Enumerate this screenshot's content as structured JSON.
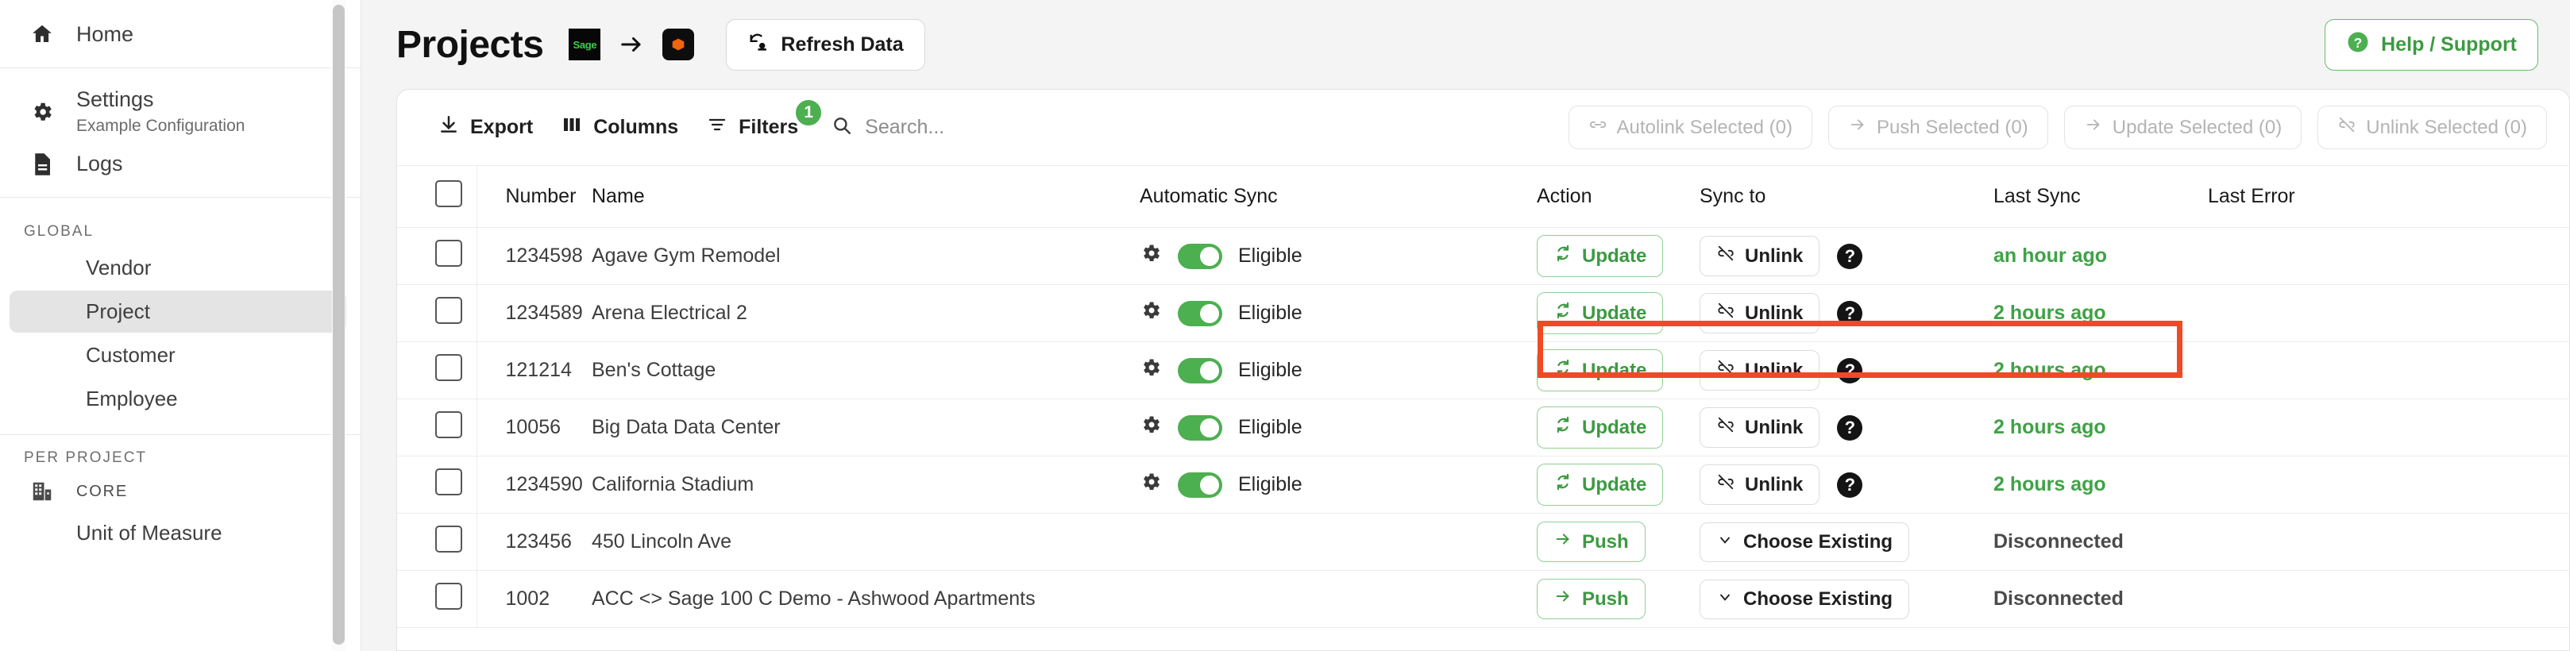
{
  "sidebar": {
    "top_items": [
      {
        "label": "Home",
        "icon": "home-icon",
        "sub": null
      }
    ],
    "mid_items": [
      {
        "label": "Settings",
        "icon": "gear-icon",
        "sub": "Example Configuration"
      },
      {
        "label": "Logs",
        "icon": "document-icon",
        "sub": null
      }
    ],
    "global_header": "GLOBAL",
    "global_items": [
      {
        "label": "Vendor",
        "active": false
      },
      {
        "label": "Project",
        "active": true
      },
      {
        "label": "Customer",
        "active": false
      },
      {
        "label": "Employee",
        "active": false
      }
    ],
    "per_project_header": "PER PROJECT",
    "core_label": "CORE",
    "core_icon": "building-icon",
    "cut_item": "Unit of Measure"
  },
  "header": {
    "title": "Projects",
    "source_logo_text": "Sage",
    "arrow_icon": "arrow-right-icon",
    "target_logo_icon": "command-center-icon",
    "refresh_label": "Refresh Data",
    "refresh_icon": "refresh-data-icon",
    "help_label": "Help / Support",
    "help_icon": "question-circle-icon"
  },
  "toolbar": {
    "export_label": "Export",
    "export_icon": "download-icon",
    "columns_label": "Columns",
    "columns_icon": "columns-icon",
    "filters_label": "Filters",
    "filters_icon": "filter-icon",
    "filters_badge": "1",
    "search_placeholder": "Search...",
    "search_value": "",
    "search_icon": "search-icon",
    "bulk_actions": [
      {
        "label": "Autolink Selected (0)",
        "icon": "link-icon",
        "disabled": true
      },
      {
        "label": "Push Selected (0)",
        "icon": "arrow-right-icon",
        "disabled": true
      },
      {
        "label": "Update Selected (0)",
        "icon": "arrow-right-icon",
        "disabled": true
      },
      {
        "label": "Unlink Selected (0)",
        "icon": "unlink-icon",
        "disabled": true
      }
    ]
  },
  "table": {
    "columns": [
      "",
      "Number",
      "Name",
      "Automatic Sync",
      "Action",
      "Sync to",
      "Last Sync",
      "Last Error"
    ],
    "rows": [
      {
        "number": "1234598",
        "name": "Agave Gym Remodel",
        "auto_sync": true,
        "auto_sync_label": "Eligible",
        "action_label": "Update",
        "action_icon": "refresh-icon",
        "action_style": "green",
        "sync_to_label": "Unlink",
        "sync_to_icon": "unlink-icon",
        "sync_to_style": "neutral",
        "has_help": true,
        "last_sync": "an hour ago",
        "last_sync_style": "ok",
        "last_error": "",
        "highlighted": true
      },
      {
        "number": "1234589",
        "name": "Arena Electrical 2",
        "auto_sync": true,
        "auto_sync_label": "Eligible",
        "action_label": "Update",
        "action_icon": "refresh-icon",
        "action_style": "green",
        "sync_to_label": "Unlink",
        "sync_to_icon": "unlink-icon",
        "sync_to_style": "neutral",
        "has_help": true,
        "last_sync": "2 hours ago",
        "last_sync_style": "ok",
        "last_error": "",
        "highlighted": false
      },
      {
        "number": "121214",
        "name": "Ben's Cottage",
        "auto_sync": true,
        "auto_sync_label": "Eligible",
        "action_label": "Update",
        "action_icon": "refresh-icon",
        "action_style": "green",
        "sync_to_label": "Unlink",
        "sync_to_icon": "unlink-icon",
        "sync_to_style": "neutral",
        "has_help": true,
        "last_sync": "2 hours ago",
        "last_sync_style": "ok",
        "last_error": "",
        "highlighted": false
      },
      {
        "number": "10056",
        "name": "Big Data Data Center",
        "auto_sync": true,
        "auto_sync_label": "Eligible",
        "action_label": "Update",
        "action_icon": "refresh-icon",
        "action_style": "green",
        "sync_to_label": "Unlink",
        "sync_to_icon": "unlink-icon",
        "sync_to_style": "neutral",
        "has_help": true,
        "last_sync": "2 hours ago",
        "last_sync_style": "ok",
        "last_error": "",
        "highlighted": false
      },
      {
        "number": "1234590",
        "name": "California Stadium",
        "auto_sync": true,
        "auto_sync_label": "Eligible",
        "action_label": "Update",
        "action_icon": "refresh-icon",
        "action_style": "green",
        "sync_to_label": "Unlink",
        "sync_to_icon": "unlink-icon",
        "sync_to_style": "neutral",
        "has_help": true,
        "last_sync": "2 hours ago",
        "last_sync_style": "ok",
        "last_error": "",
        "highlighted": false
      },
      {
        "number": "123456",
        "name": "450 Lincoln Ave",
        "auto_sync": null,
        "auto_sync_label": "",
        "action_label": "Push",
        "action_icon": "arrow-right-icon",
        "action_style": "green",
        "sync_to_label": "Choose Existing",
        "sync_to_icon": "chevron-down-icon",
        "sync_to_style": "neutral",
        "has_help": false,
        "last_sync": "Disconnected",
        "last_sync_style": "off",
        "last_error": "",
        "highlighted": false
      },
      {
        "number": "1002",
        "name": "ACC <> Sage 100 C Demo - Ashwood Apartments",
        "auto_sync": null,
        "auto_sync_label": "",
        "action_label": "Push",
        "action_icon": "arrow-right-icon",
        "action_style": "green",
        "sync_to_label": "Choose Existing",
        "sync_to_icon": "chevron-down-icon",
        "sync_to_style": "neutral",
        "has_help": false,
        "last_sync": "Disconnected",
        "last_sync_style": "off",
        "last_error": "",
        "highlighted": false
      }
    ]
  },
  "colors": {
    "accent_green": "#4caf50",
    "green_text": "#3c9a41",
    "highlight_red": "#f04a25",
    "page_bg": "#f4f4f4"
  }
}
